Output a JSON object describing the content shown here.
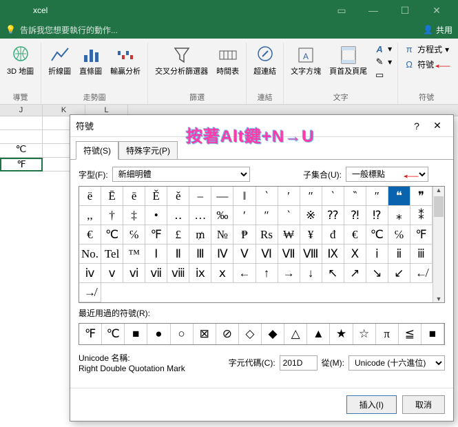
{
  "titlebar": {
    "app": "xcel"
  },
  "tellme": {
    "placeholder": "告訴我您想要執行的動作...",
    "share": "共用"
  },
  "ribbon": {
    "groups": [
      {
        "label": "導覽",
        "items": [
          "3D 地圖"
        ]
      },
      {
        "label": "走勢圖",
        "items": [
          "折線圖",
          "直條圖",
          "輸贏分析"
        ]
      },
      {
        "label": "篩選",
        "items": [
          "交叉分析篩選器",
          "時間表"
        ]
      },
      {
        "label": "連結",
        "items": [
          "超連結"
        ]
      },
      {
        "label": "文字",
        "items": [
          "文字方塊",
          "頁首及頁尾"
        ]
      },
      {
        "label": "符號",
        "eq": "方程式",
        "sym": "符號"
      }
    ]
  },
  "sheet": {
    "cols": [
      "J",
      "K",
      "L"
    ],
    "cells": [
      "℃",
      "℉"
    ]
  },
  "annotation": "按著Alt鍵+N→U",
  "dialog": {
    "title": "符號",
    "tabs": [
      "符號(S)",
      "特殊字元(P)"
    ],
    "font_label": "字型(F):",
    "font_value": "新細明體",
    "subset_label": "子集合(U):",
    "subset_value": "一般標點",
    "grid": [
      [
        "ë",
        "Ē",
        "ē",
        "Ě",
        "ě",
        "–",
        "—",
        "‖",
        "‵",
        "′",
        "″",
        "‵",
        "‶",
        "″",
        "❝",
        "❞",
        ",,"
      ],
      [
        "†",
        "‡",
        "•",
        "‥",
        "…",
        "‰",
        "′",
        "″",
        "‵",
        "※",
        "⁇",
        "⁈",
        "⁉",
        "⁎",
        "⁑",
        "€"
      ],
      [
        "℃",
        "℅",
        "℉",
        "£",
        "₥",
        "№",
        "₱",
        "Rs",
        "₩",
        "¥",
        "đ",
        "€",
        "℃",
        "℅",
        "℉",
        "No."
      ],
      [
        "Tel",
        "™",
        "Ⅰ",
        "Ⅱ",
        "Ⅲ",
        "Ⅳ",
        "Ⅴ",
        "Ⅵ",
        "Ⅶ",
        "Ⅷ",
        "Ⅸ",
        "Ⅹ",
        "ⅰ",
        "ⅱ",
        "ⅲ",
        "ⅳ"
      ],
      [
        "ⅴ",
        "ⅵ",
        "ⅶ",
        "ⅷ",
        "ⅸ",
        "ⅹ",
        "←",
        "↑",
        "→",
        "↓",
        "↖",
        "↗",
        "↘",
        "↙",
        "↚",
        "↛"
      ]
    ],
    "selected": [
      0,
      14
    ],
    "recent_label": "最近用過的符號(R):",
    "recent": [
      "℉",
      "℃",
      "■",
      "●",
      "○",
      "⊠",
      "⊘",
      "◇",
      "◆",
      "△",
      "▲",
      "★",
      "☆",
      "π",
      "≦",
      "■"
    ],
    "uname_label": "Unicode 名稱:",
    "uname_value": "Right Double Quotation Mark",
    "code_label": "字元代碼(C):",
    "code_value": "201D",
    "from_label": "從(M):",
    "from_value": "Unicode (十六進位)",
    "insert": "插入(I)",
    "cancel": "取消"
  }
}
